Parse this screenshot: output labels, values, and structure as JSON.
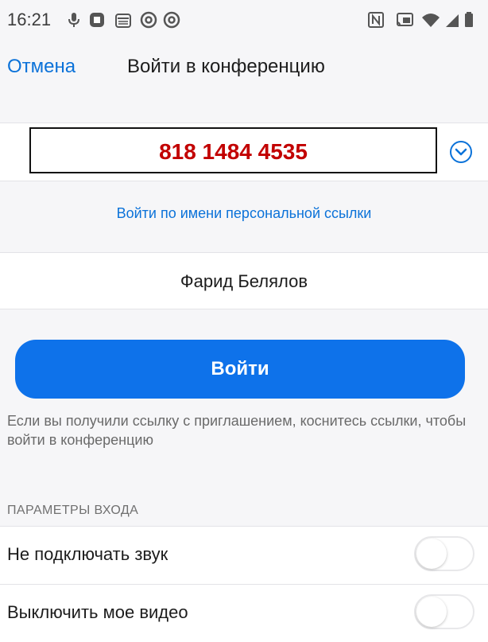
{
  "status_bar": {
    "time": "16:21",
    "left_icons": [
      "microphone-icon",
      "notification-icon",
      "calendar-icon",
      "at-icon",
      "at-icon"
    ],
    "right_icons": [
      "nfc-icon",
      "cast-icon",
      "wifi-icon",
      "signal-icon",
      "battery-icon"
    ]
  },
  "header": {
    "cancel_label": "Отмена",
    "title": "Войти в конференцию"
  },
  "meeting": {
    "id": "818 1484 4535",
    "highlight_color": "#c20000"
  },
  "personal_link_text": "Войти по имени персональной ссылки",
  "name_field": {
    "value": "Фарид Белялов"
  },
  "join_button_label": "Войти",
  "hint": "Если вы получили ссылку с приглашением, коснитесь ссылки, чтобы войти в конференцию",
  "params": {
    "heading": "ПАРАМЕТРЫ ВХОДА",
    "options": [
      {
        "label": "Не подключать звук",
        "enabled": false
      },
      {
        "label": "Выключить мое видео",
        "enabled": false
      }
    ]
  },
  "colors": {
    "accent": "#0e72ea",
    "link": "#0b72d9",
    "background": "#f6f6f8"
  }
}
